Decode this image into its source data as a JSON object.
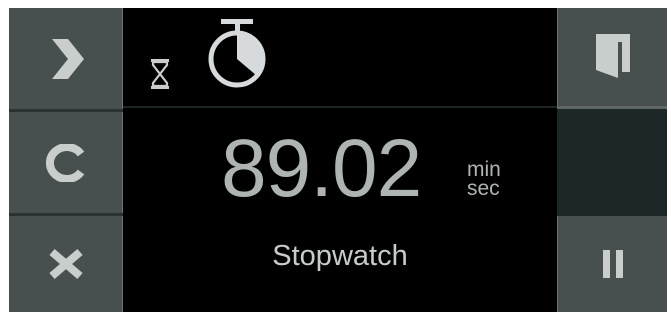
{
  "display": {
    "time_value": "89.02",
    "unit_top": "min",
    "unit_bottom": "sec",
    "mode_label": "Stopwatch"
  },
  "icons": {
    "next": "chevron-right-icon",
    "clear": "clear-c-icon",
    "close": "close-x-icon",
    "door": "door-icon",
    "pause": "pause-icon",
    "timer": "hourglass-icon",
    "stopwatch": "stopwatch-icon"
  },
  "colors": {
    "button_bg": "#47504f",
    "display_bg": "#000000",
    "icon_light": "#c9cecd",
    "dark_panel": "#1c2827"
  }
}
